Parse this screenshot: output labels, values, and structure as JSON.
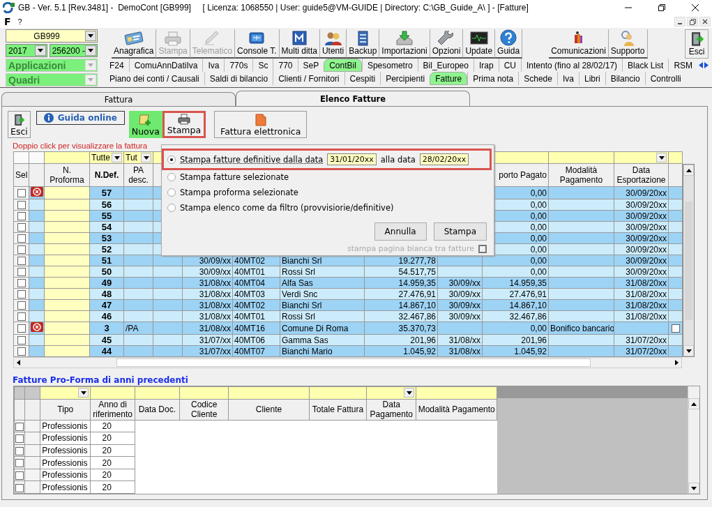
{
  "window": {
    "title": "GB - Ver. 5.1 [Rev.3481] -  DemoCont [GB999]     [ Licenza: 1068550 | User: guide5@VM-GUIDE | Directory: C:\\GB_Guide_A\\ ] - [Fatture]"
  },
  "menu": [
    "F",
    "?"
  ],
  "selectors": {
    "company": "GB999",
    "year": "2017",
    "code": "256200 -",
    "applicazioni": "Applicazioni",
    "quadri": "Quadri"
  },
  "toolbar": [
    {
      "label": "Anagrafica",
      "disabled": false
    },
    {
      "label": "Stampa",
      "disabled": true
    },
    {
      "label": "Telematico",
      "disabled": true
    },
    {
      "label": "Console T.",
      "disabled": false
    },
    {
      "label": "Multi ditta",
      "disabled": false
    },
    {
      "label": "Utenti",
      "disabled": false
    },
    {
      "label": "Backup",
      "disabled": false
    },
    {
      "label": "Importazioni",
      "disabled": false
    },
    {
      "label": "Opzioni",
      "disabled": false
    },
    {
      "label": "Update",
      "disabled": false
    },
    {
      "label": "Guida",
      "disabled": false
    }
  ],
  "toolbar_right": [
    {
      "label": "Comunicazioni",
      "disabled": false
    },
    {
      "label": "Supporto",
      "disabled": false
    }
  ],
  "exit_button": "Esci",
  "app_tabs": [
    {
      "label": "F24",
      "selected": false
    },
    {
      "label": "ComuAnnDatiIva",
      "selected": false
    },
    {
      "label": "Iva",
      "selected": false
    },
    {
      "label": "770s",
      "selected": false
    },
    {
      "label": "Sc",
      "selected": false
    },
    {
      "label": "770",
      "selected": false
    },
    {
      "label": "SeP",
      "selected": false
    },
    {
      "label": "ContBil",
      "selected": true
    },
    {
      "label": "Spesometro",
      "selected": false
    },
    {
      "label": "Bil_Europeo",
      "selected": false
    },
    {
      "label": "Irap",
      "selected": false
    },
    {
      "label": "CU",
      "selected": false
    },
    {
      "label": "Intento (fino al 28/02/17)",
      "selected": false
    },
    {
      "label": "Black List",
      "selected": false
    },
    {
      "label": "RSM",
      "selected": false
    }
  ],
  "section_tabs": [
    {
      "label": "Piano dei conti / Causali",
      "selected": false
    },
    {
      "label": "Saldi di bilancio",
      "selected": false
    },
    {
      "label": "Clienti / Fornitori",
      "selected": false
    },
    {
      "label": "Cespiti",
      "selected": false
    },
    {
      "label": "Percipienti",
      "selected": false
    },
    {
      "label": "Fatture",
      "selected": true
    },
    {
      "label": "Prima nota",
      "selected": false
    },
    {
      "label": "Schede",
      "selected": false
    },
    {
      "label": "Iva",
      "selected": false
    },
    {
      "label": "Libri",
      "selected": false
    },
    {
      "label": "Bilancio",
      "selected": false
    },
    {
      "label": "Controlli",
      "selected": false
    }
  ],
  "page_tabs": [
    {
      "label": "Fattura",
      "selected": false
    },
    {
      "label": "Elenco Fatture",
      "selected": true
    }
  ],
  "actions": [
    {
      "label": "Esci",
      "highlighted": false
    },
    {
      "label": "Guida online",
      "highlighted": false
    },
    {
      "label": "Nuova",
      "highlighted": false
    },
    {
      "label": "Stampa",
      "highlighted": true
    },
    {
      "label": "Fattura elettronica",
      "highlighted": false
    }
  ],
  "hint": "Doppio click per visualizzare la fattura",
  "invoices": {
    "filters": {
      "n_def": "Tutte",
      "pa_desc": "Tut"
    },
    "columns": {
      "sel": "Sel",
      "n_proforma": "N. Proforma",
      "n_def": "N.Def.",
      "pa_desc": "PA desc.",
      "importo": "porto Pagato",
      "modalita": "Modalità Pagamento",
      "data_esp": "Data Esportazione"
    },
    "rows": [
      {
        "kind": "invoice",
        "checked": false,
        "error": true,
        "n_def": "57",
        "importo": "0,00",
        "data_esp": "30/09/20xx"
      },
      {
        "kind": "invoice",
        "checked": false,
        "error": false,
        "n_def": "56",
        "importo": "0,00",
        "data_esp": "30/09/20xx"
      },
      {
        "kind": "invoice",
        "checked": false,
        "error": false,
        "n_def": "55",
        "importo": "0,00",
        "data_esp": "30/09/20xx"
      },
      {
        "kind": "invoice",
        "checked": false,
        "error": false,
        "n_def": "54",
        "importo": "0,00",
        "data_esp": "30/09/20xx"
      },
      {
        "kind": "invoice",
        "checked": false,
        "error": false,
        "n_def": "53",
        "importo": "0,00",
        "data_esp": "30/09/20xx"
      },
      {
        "kind": "invoice",
        "checked": false,
        "error": false,
        "n_def": "52",
        "importo": "0,00",
        "data_esp": "30/09/20xx"
      },
      {
        "kind": "invoice",
        "checked": false,
        "error": false,
        "n_def": "51",
        "data_doc": "30/09/xx",
        "codice": "40MT02",
        "cliente": "Bianchi Srl",
        "totale": "19.277,78",
        "importo": "0,00",
        "data_esp": "30/09/20xx"
      },
      {
        "kind": "invoice",
        "checked": false,
        "error": false,
        "n_def": "50",
        "data_doc": "30/09/xx",
        "codice": "40MT01",
        "cliente": "Rossi Srl",
        "totale": "54.517,75",
        "importo": "0,00",
        "data_esp": "30/09/20xx"
      },
      {
        "kind": "invoice",
        "checked": false,
        "error": false,
        "n_def": "49",
        "data_doc": "31/08/xx",
        "codice": "40MT04",
        "cliente": "Alfa Sas",
        "totale": "14.959,35",
        "data_pag": "30/09/xx",
        "importo": "14.959,35",
        "data_esp": "31/08/20xx"
      },
      {
        "kind": "invoice",
        "checked": false,
        "error": false,
        "n_def": "48",
        "data_doc": "31/08/xx",
        "codice": "40MT03",
        "cliente": "Verdi Snc",
        "totale": "27.476,91",
        "data_pag": "30/09/xx",
        "importo": "27.476,91",
        "data_esp": "31/08/20xx"
      },
      {
        "kind": "invoice",
        "checked": false,
        "error": false,
        "n_def": "47",
        "data_doc": "31/08/xx",
        "codice": "40MT02",
        "cliente": "Bianchi Srl",
        "totale": "14.867,10",
        "data_pag": "30/09/xx",
        "importo": "14.867,10",
        "data_esp": "31/08/20xx"
      },
      {
        "kind": "invoice",
        "checked": false,
        "error": false,
        "n_def": "46",
        "data_doc": "31/08/xx",
        "codice": "40MT01",
        "cliente": "Rossi Srl",
        "totale": "32.467,86",
        "data_pag": "30/09/xx",
        "importo": "32.467,86",
        "data_esp": "31/08/20xx"
      },
      {
        "kind": "pa",
        "checked": false,
        "error": true,
        "n_def": "3",
        "pa_desc": "/PA",
        "data_doc": "31/08/xx",
        "codice": "40MT16",
        "cliente": "Comune Di Roma",
        "totale": "35.370,73",
        "importo": "0,00",
        "modalita": "Bonifico bancario"
      },
      {
        "kind": "invoice",
        "checked": false,
        "error": false,
        "n_def": "45",
        "data_doc": "31/07/xx",
        "codice": "40MT06",
        "cliente": "Gamma Sas",
        "totale": "201,96",
        "data_pag": "31/08/xx",
        "importo": "201,96",
        "data_esp": "31/07/20xx"
      },
      {
        "kind": "invoice",
        "checked": false,
        "error": false,
        "n_def": "44",
        "data_doc": "31/07/xx",
        "codice": "40MT07",
        "cliente": "Bianchi Mario",
        "totale": "1.045,92",
        "data_pag": "31/08/xx",
        "importo": "1.045,92",
        "data_esp": "31/07/20xx"
      }
    ]
  },
  "print_dialog": {
    "options": [
      {
        "label": "Stampa fatture definitive dalla data",
        "selected": true,
        "highlighted": true
      },
      {
        "label": "Stampa fatture selezionate",
        "selected": false,
        "highlighted": false
      },
      {
        "label": "Stampa proforma selezionate",
        "selected": false,
        "highlighted": false
      },
      {
        "label": "Stampa elenco come da filtro (provvisiorie/definitive)",
        "selected": false,
        "highlighted": false
      }
    ],
    "from_date": "31/01/20xx",
    "to_label": "alla data",
    "to_date": "28/02/20xx",
    "buttons": [
      "Annulla",
      "Stampa"
    ],
    "blank_page": {
      "label": "stampa pagina bianca tra fatture",
      "checked": false,
      "disabled": true
    }
  },
  "proforma": {
    "title": "Fatture Pro-Forma di anni precedenti",
    "columns": [
      "Tipo",
      "Anno di riferimento",
      "Data Doc.",
      "Codice Cliente",
      "Cliente",
      "Totale Fattura",
      "Data Pagamento",
      "Modalità Pagamento"
    ],
    "rows": [
      {
        "checked": false,
        "tipo": "Professionis",
        "anno": "20"
      },
      {
        "checked": false,
        "tipo": "Professionis",
        "anno": "20"
      },
      {
        "checked": false,
        "tipo": "Professionis",
        "anno": "20"
      },
      {
        "checked": false,
        "tipo": "Professionis",
        "anno": "20"
      },
      {
        "checked": false,
        "tipo": "Professionis",
        "anno": "20"
      },
      {
        "checked": false,
        "tipo": "Professionis",
        "anno": "20"
      }
    ]
  }
}
